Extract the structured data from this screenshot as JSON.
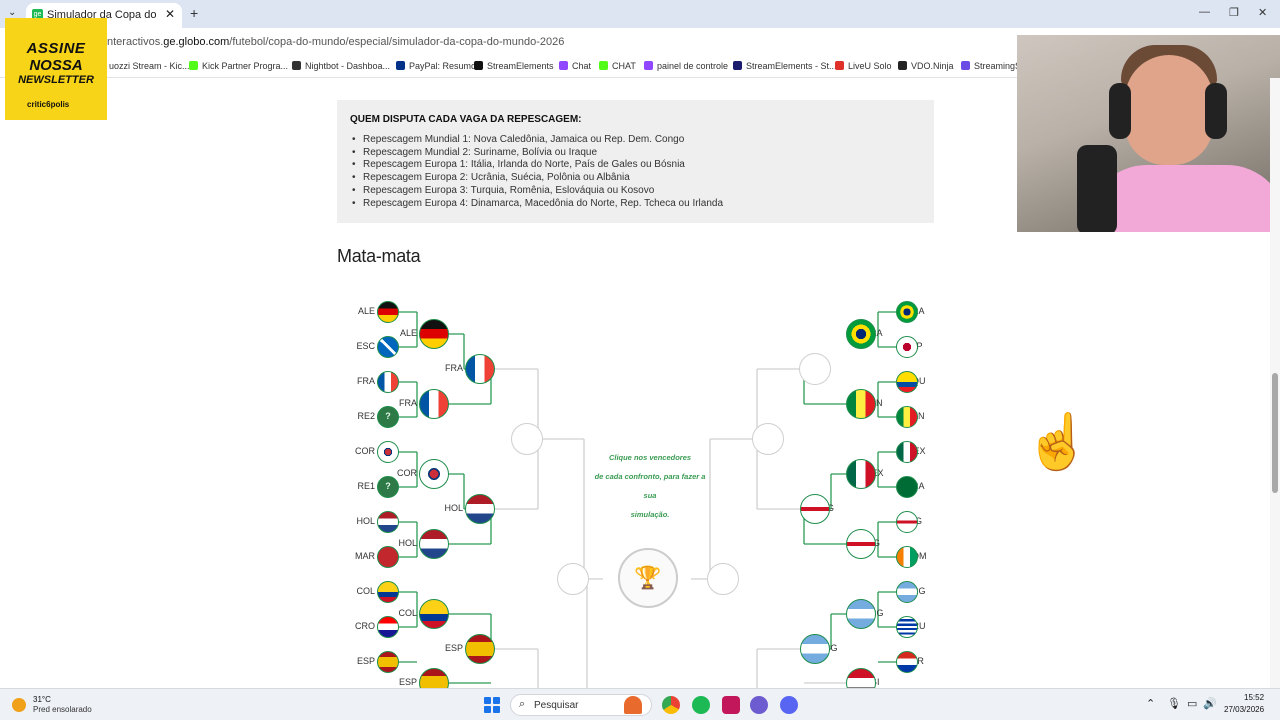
{
  "browser": {
    "tab_title": "Simulador da Copa do Mundo",
    "tab_favicon": "ge",
    "new_tab": "+",
    "close": "✕",
    "url_prefix": "nteractivos.",
    "url_domain": "ge.globo.com",
    "url_path": "/futebol/copa-do-mundo/especial/simulador-da-copa-do-mundo-2026"
  },
  "bookmarks": [
    {
      "label": "uozzi Stream - Kic...",
      "icon_color": "#ffffff"
    },
    {
      "label": "Kick Partner Progra...",
      "icon_color": "#53fc18"
    },
    {
      "label": "Nightbot - Dashboa...",
      "icon_color": "#333333"
    },
    {
      "label": "PayPal: Resumo",
      "icon_color": "#003087"
    },
    {
      "label": "StreamElements",
      "icon_color": "#111111"
    },
    {
      "label": "Chat",
      "icon_color": "#9146ff"
    },
    {
      "label": "CHAT",
      "icon_color": "#53fc18"
    },
    {
      "label": "painel de controle",
      "icon_color": "#9146ff"
    },
    {
      "label": "StreamElements - St...",
      "icon_color": "#1b1b6e"
    },
    {
      "label": "LiveU Solo",
      "icon_color": "#e0302a"
    },
    {
      "label": "VDO.Ninja",
      "icon_color": "#222222"
    },
    {
      "label": "StreamingS",
      "icon_color": "#6b4de6"
    }
  ],
  "newsletter": {
    "line1": "ASSINE",
    "line2": "NOSSA",
    "line3": "NEWSLETTER",
    "brand": "critic6polis"
  },
  "repescagem": {
    "heading": "QUEM DISPUTA CADA VAGA DA REPESCAGEM:",
    "items": [
      "Repescagem Mundial 1: Nova Caledônia, Jamaica ou Rep. Dem. Congo",
      "Repescagem Mundial 2: Suriname, Bolívia ou Iraque",
      "Repescagem Europa 1: Itália, Irlanda do Norte, País de Gales ou Bósnia",
      "Repescagem Europa 2: Ucrânia, Suécia, Polônia ou Albânia",
      "Repescagem Europa 3: Turquia, Romênia, Eslováquia ou Kosovo",
      "Repescagem Europa 4: Dinamarca, Macedônia do Norte, Rep. Tcheca ou Irlanda"
    ]
  },
  "section_title": "Mata-mata",
  "bracket": {
    "hint_lines": [
      "Clique nos vencedores",
      "de cada confronto, para fazer a sua",
      "simulação."
    ],
    "left_r1": [
      "ALE",
      "ESC",
      "FRA",
      "RE2",
      "COR",
      "RE1",
      "HOL",
      "MAR",
      "COL",
      "CRO",
      "ESP"
    ],
    "left_r2": [
      "ALE",
      "FRA",
      "COR",
      "HOL",
      "COL",
      "ESP"
    ],
    "left_r3": [
      "FRA",
      "HOL",
      "ESP"
    ],
    "right_r1": [
      "BRA",
      "JAP",
      "EQU",
      "SEN",
      "MEX",
      "ARA",
      "ING",
      "CDM",
      "ARG",
      "URU",
      "PAR"
    ],
    "right_r2": [
      "BRA",
      "SEN",
      "MEX",
      "ING",
      "ARG",
      "EGI"
    ],
    "right_r3": [
      "ING",
      "ARG"
    ],
    "unknown_mark": "?"
  },
  "taskbar": {
    "temperature": "31°C",
    "weather": "Pred ensolarado",
    "search": "Pesquisar",
    "time": "15:52",
    "date": "27/03/2026"
  }
}
